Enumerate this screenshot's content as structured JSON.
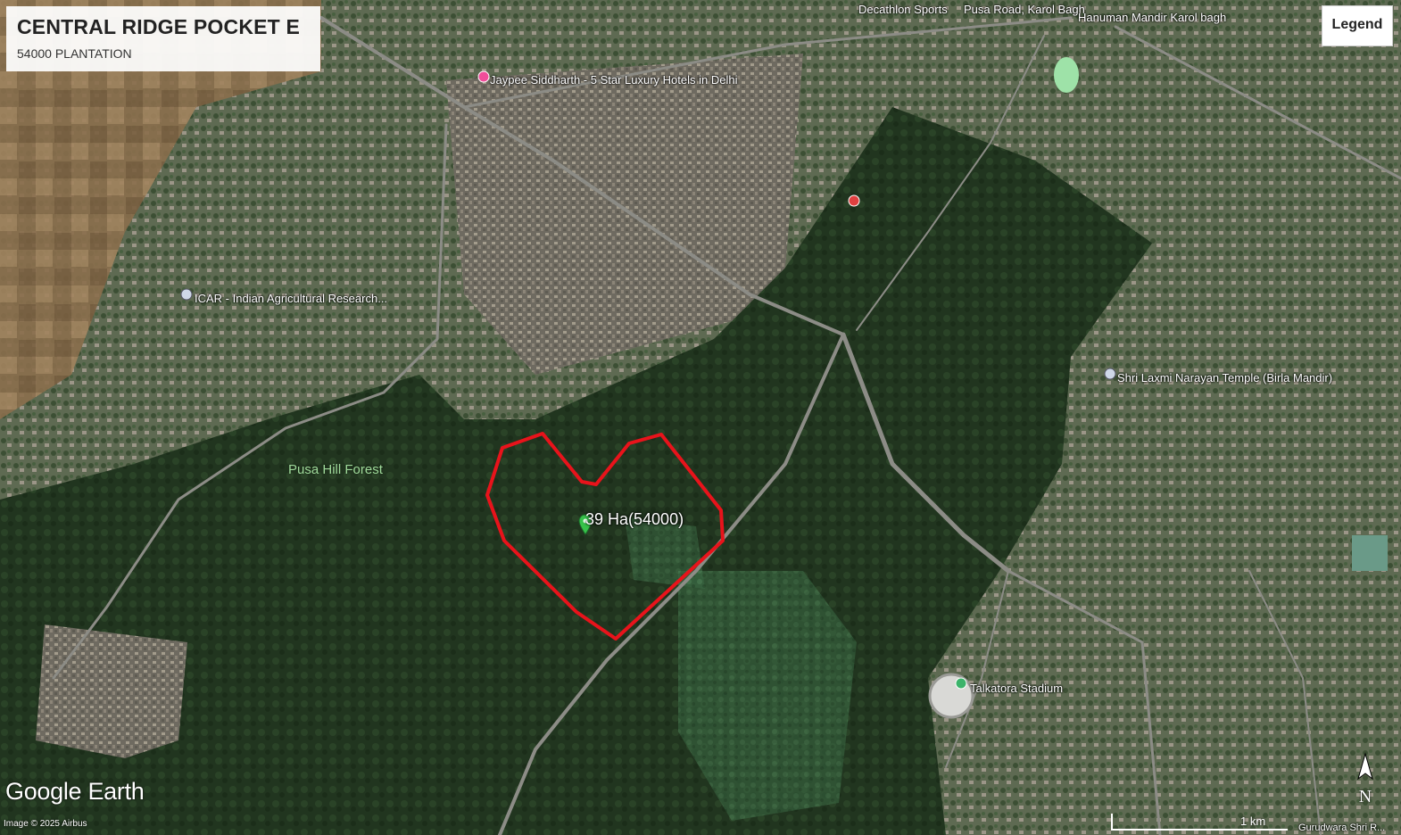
{
  "title_box": {
    "title": "CENTRAL RIDGE POCKET E",
    "subtitle": "54000 PLANTATION"
  },
  "legend_button": {
    "label": "Legend"
  },
  "places": {
    "decathlon": "Decathlon Sports",
    "pusa_road": "Pusa Road, Karol Bagh",
    "hanuman": "Hanuman Mandir Karol bagh",
    "jaypee": "Jaypee Siddharth - 5 Star Luxury Hotels in Delhi",
    "icar": "ICAR - Indian Agricultural Research...",
    "birla": "Shri Laxmi Narayan Temple (Birla Mandir)",
    "pusa_forest": "Pusa Hill Forest",
    "talkatora": "Talkatora Stadium",
    "gurudwara": "Gurudwara Shri R..."
  },
  "plantation_area": {
    "label": "39 Ha(54000)",
    "outline_color": "#e8131b"
  },
  "map_branding": {
    "brand": "Google Earth",
    "credit": "Image © 2025 Airbus"
  },
  "scale_bar": {
    "label": "1 km"
  },
  "north_arrow": {
    "label": "N"
  },
  "colors": {
    "forest": "#233a22",
    "urban": "#7a7466",
    "farmland": "#9a7a56",
    "road": "#8a8a86",
    "marker": "#37c24a"
  }
}
